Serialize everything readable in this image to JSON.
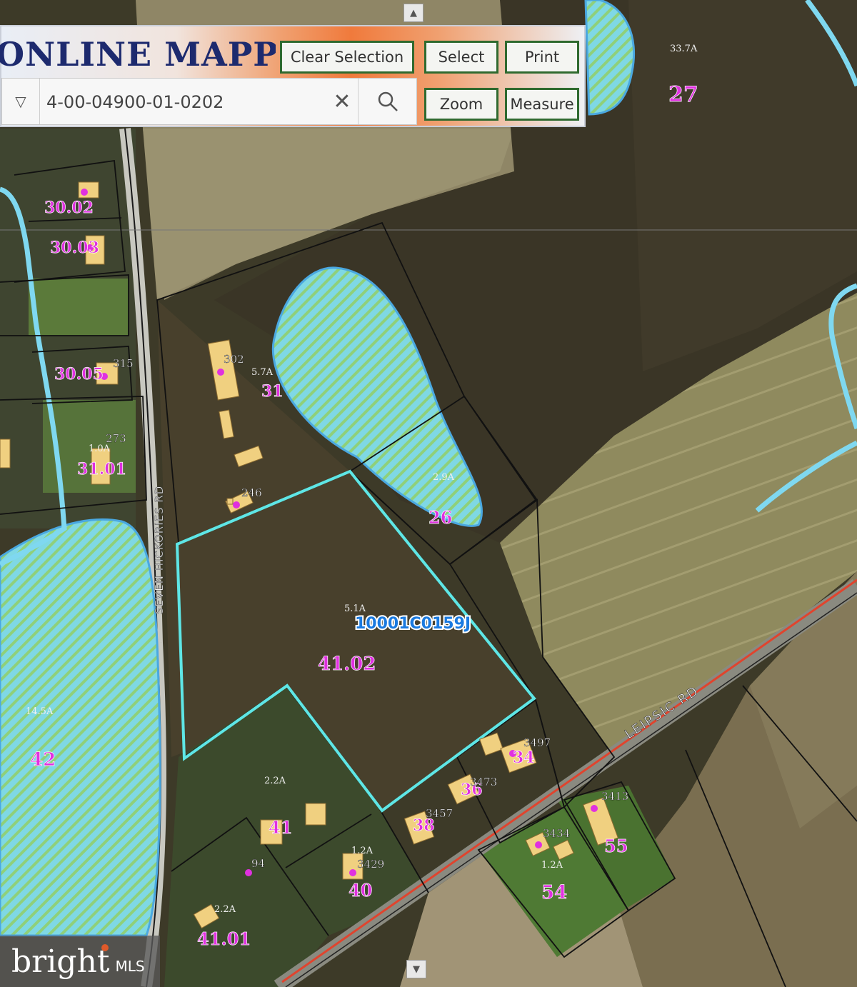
{
  "app": {
    "title": "ONLINE MAPPIN"
  },
  "toolbar": {
    "clear_selection": "Clear Selection",
    "select": "Select",
    "print": "Print",
    "zoom": "Zoom",
    "measure": "Measure"
  },
  "search": {
    "value": "4-00-04900-01-0202"
  },
  "map": {
    "flood_zone_label": "10001C0159J",
    "flood_zone_label_top": "10001C0159J",
    "parcels": [
      {
        "id": "41.02",
        "acreage": "5.1A"
      },
      {
        "id": "31",
        "acreage": "5.7A"
      },
      {
        "id": "26",
        "acreage": "2.9A"
      },
      {
        "id": "27",
        "acreage": "33.7A"
      },
      {
        "id": "42",
        "acreage": "14.5A"
      },
      {
        "id": "41",
        "acreage": "2.2A"
      },
      {
        "id": "41.01",
        "acreage": "2.2A"
      },
      {
        "id": "40",
        "acreage": "1.2A"
      },
      {
        "id": "38",
        "acreage": ""
      },
      {
        "id": "36",
        "acreage": ""
      },
      {
        "id": "34",
        "acreage": ""
      },
      {
        "id": "54",
        "acreage": "1.2A"
      },
      {
        "id": "55",
        "acreage": ""
      },
      {
        "id": "30.02",
        "acreage": ""
      },
      {
        "id": "30.03",
        "acreage": ""
      },
      {
        "id": "30.05",
        "acreage": ""
      },
      {
        "id": "31.01",
        "acreage": "1.0A"
      }
    ],
    "addresses": [
      "302",
      "246",
      "3497",
      "3473",
      "3457",
      "3429",
      "3434",
      "3413",
      "315",
      "273",
      "94"
    ],
    "roads": [
      "LEIPSIC RD",
      "SEVEN HICKORIES RD"
    ],
    "colors": {
      "parcel_line": "#111111",
      "selected_parcel": "#5ee6e6",
      "flood_fill": "#7fd8e4",
      "flood_stripe": "#8fd07a",
      "label": "#e030e0",
      "road_red": "#e0442e"
    }
  },
  "watermark": {
    "brand": "bright",
    "suffix": "MLS"
  }
}
